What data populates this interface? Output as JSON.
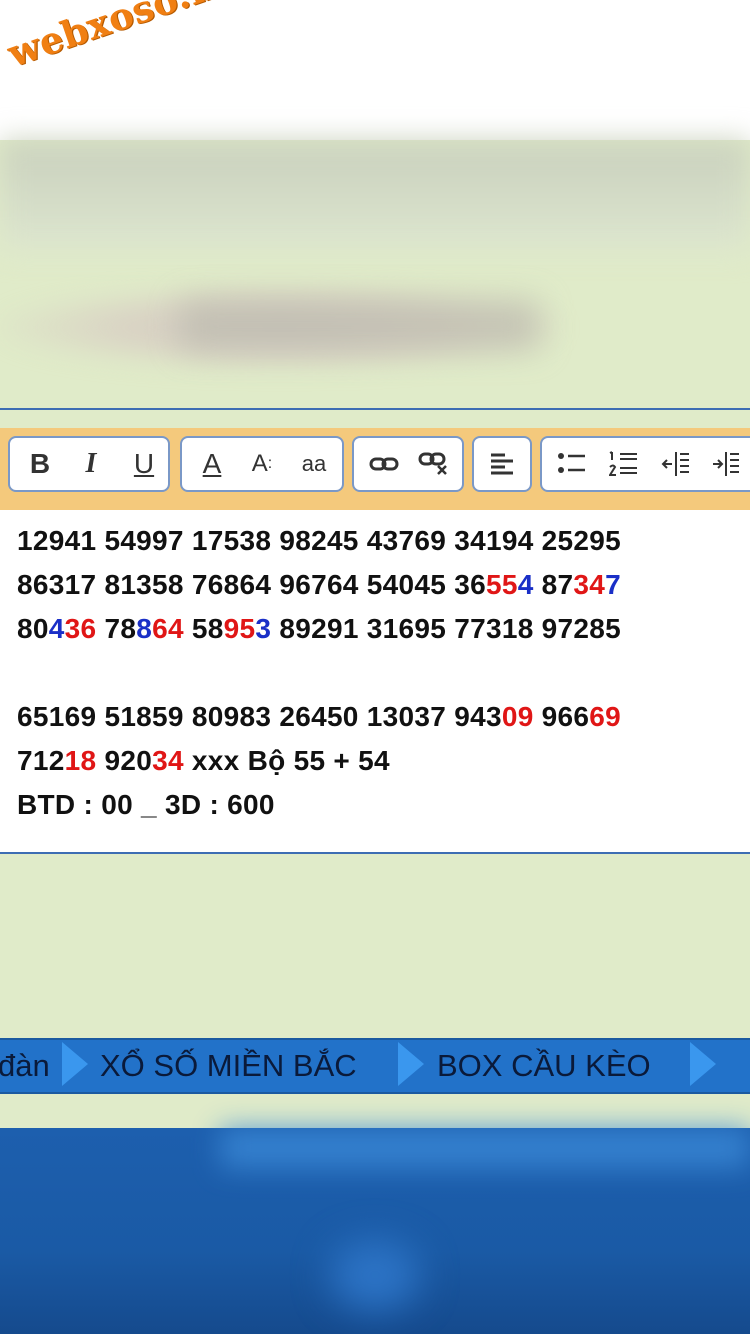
{
  "logo": {
    "text": "webxoso.net",
    "color": "#f07f13"
  },
  "toolbar": {
    "bold": "B",
    "italic": "I",
    "underline": "U",
    "font_color": "A",
    "font_size": "A",
    "font_face": "aa",
    "icons": [
      "link-icon",
      "unlink-icon",
      "align-left-icon",
      "bulleted-list-icon",
      "numbered-list-icon",
      "outdent-icon",
      "indent-icon"
    ]
  },
  "editor": {
    "lines": [
      [
        {
          "t": "12941 54997 17538 98245 43769 34194 25295",
          "c": "k"
        }
      ],
      [
        {
          "t": "86317 81358 76864 96764 54045 36",
          "c": "k"
        },
        {
          "t": "55",
          "c": "r"
        },
        {
          "t": "4",
          "c": "b"
        },
        {
          "t": " 87",
          "c": "k"
        },
        {
          "t": "34",
          "c": "r"
        },
        {
          "t": "7",
          "c": "b"
        }
      ],
      [
        {
          "t": "80",
          "c": "k"
        },
        {
          "t": "4",
          "c": "b"
        },
        {
          "t": "36",
          "c": "r"
        },
        {
          "t": " 78",
          "c": "k"
        },
        {
          "t": "8",
          "c": "b"
        },
        {
          "t": "64",
          "c": "r"
        },
        {
          "t": " 58",
          "c": "k"
        },
        {
          "t": "95",
          "c": "r"
        },
        {
          "t": "3",
          "c": "b"
        },
        {
          "t": " 89291 31695 77318 97285",
          "c": "k"
        }
      ],
      [],
      [
        {
          "t": "65169 51859 80983 26450 13037 943",
          "c": "k"
        },
        {
          "t": "09",
          "c": "r"
        },
        {
          "t": " 966",
          "c": "k"
        },
        {
          "t": "69",
          "c": "r"
        }
      ],
      [
        {
          "t": "712",
          "c": "k"
        },
        {
          "t": "18",
          "c": "r"
        },
        {
          "t": " 920",
          "c": "k"
        },
        {
          "t": "34",
          "c": "r"
        },
        {
          "t": " xxx Bộ 55 + 54",
          "c": "k"
        }
      ],
      [
        {
          "t": "BTD : 00 _ 3D : 600",
          "c": "k"
        }
      ]
    ]
  },
  "nav": {
    "items": [
      "đàn",
      "XỔ SỐ MIỀN BẮC",
      "BOX CẦU KÈO"
    ]
  },
  "colors": {
    "accent_red": "#e01616",
    "accent_blue": "#1a2fc7",
    "nav_bg": "#2272c9",
    "page_bg": "#e0ebc9"
  }
}
